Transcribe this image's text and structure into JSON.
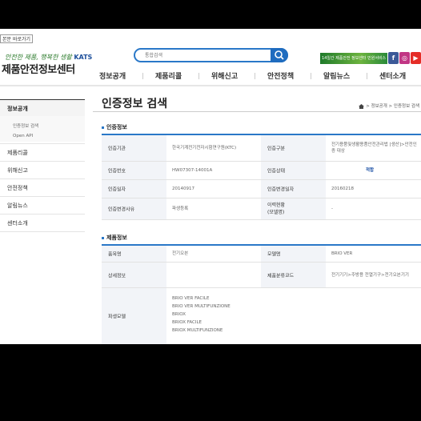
{
  "header": {
    "skip_link": "본문 바로가기",
    "logo_slogan": "안전한 제품, 행복한 생활",
    "logo_brand": "KATS",
    "logo_title": "제품안전정보센터",
    "search_placeholder": "통합검색",
    "banner_text": "14일간 제품안전 정보센터 민원서비스"
  },
  "sns": [
    {
      "icon": "facebook-icon",
      "glyph": "f",
      "color": "#3b5998"
    },
    {
      "icon": "instagram-icon",
      "glyph": "◎",
      "color": "#c13584"
    },
    {
      "icon": "youtube-icon",
      "glyph": "▶",
      "color": "#e52d27"
    }
  ],
  "gnb": [
    "정보공개",
    "제품리콜",
    "위해신고",
    "안전정책",
    "알림뉴스",
    "센터소개"
  ],
  "lnb": {
    "title": "정보공개",
    "sub": [
      "인증정보 검색",
      "Open API"
    ],
    "items": [
      "제품리콜",
      "위해신고",
      "안전정책",
      "알림뉴스",
      "센터소개"
    ]
  },
  "content": {
    "title": "인증정보 검색",
    "breadcrumb": "> 정보공개 > 인증정보 검색",
    "cert_section": "인증정보",
    "product_section": "제품정보"
  },
  "cert": {
    "agency_label": "인증기관",
    "agency_value": "한국기계전기전자시험연구원(KTC)",
    "type_label": "인증구분",
    "type_value": "전기용품및생활용품안전관리법 [생산]>안전인증 대상",
    "number_label": "인증번호",
    "number_value": "HW07307-14001A",
    "status_label": "인증상태",
    "status_value": "적합",
    "date_label": "인증일자",
    "date_value": "20140917",
    "change_date_label": "인증변경일자",
    "change_date_value": "20160218",
    "reason_label": "인증변경사유",
    "reason_value": "파생등록",
    "history_label": "이력현황\n(모델명)",
    "history_value": "-"
  },
  "product": {
    "name_label": "품목명",
    "name_value": "전기오븐",
    "model_label": "모델명",
    "model_value": "BRIO VER",
    "detail_label": "상세정보",
    "detail_value": "",
    "class_label": "제품분류코드",
    "class_value": "전기기기>주방용 전열기구>전기오븐기기",
    "derived_label": "파생모델",
    "derived_models": [
      "BRIO VER FACILE",
      "BRIO VER MULTIFUNZIONE",
      "BRIOX",
      "BRIOX FACILE",
      "BRIOX MULTIFUNZIONE"
    ]
  }
}
